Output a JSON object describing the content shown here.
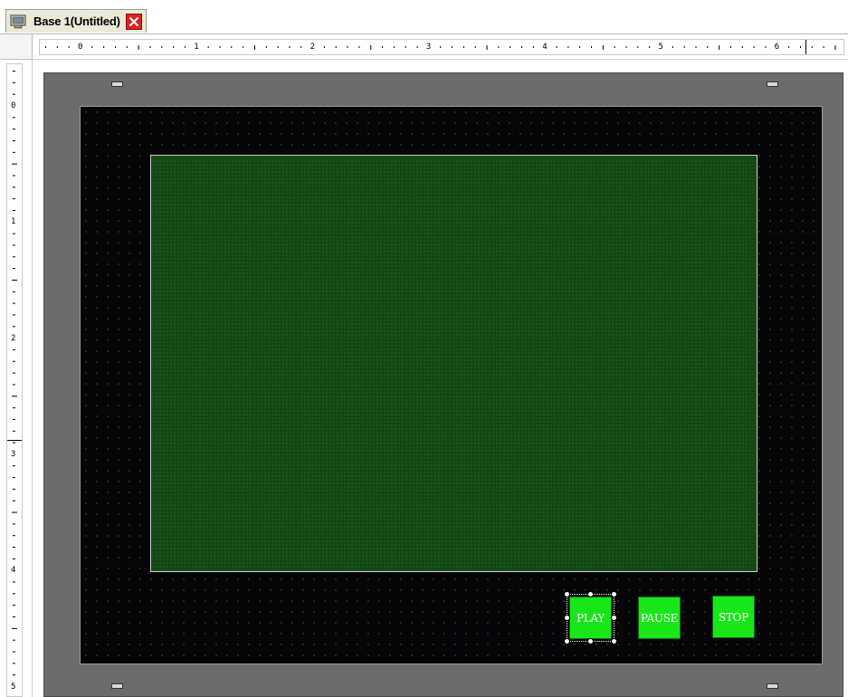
{
  "tab": {
    "title": "Base 1(Untitled)",
    "icon": "screen-window-icon",
    "close_icon": "close-icon",
    "close_color": "#d9231f"
  },
  "ruler_top": {
    "labels": [
      "0",
      "1",
      "2",
      "3",
      "4",
      "5",
      "6"
    ]
  },
  "ruler_left": {
    "labels": [
      "0",
      "1",
      "2",
      "3",
      "4",
      "5"
    ]
  },
  "screen": {
    "background": "#050507",
    "display_color": "#124612"
  },
  "buttons": [
    {
      "label": "PLAY",
      "selected": true
    },
    {
      "label": "PAUSE",
      "selected": false
    },
    {
      "label": "STOP",
      "selected": false
    }
  ],
  "colors": {
    "button_green": "#19e619",
    "frame_gray": "#6c6c6c"
  }
}
